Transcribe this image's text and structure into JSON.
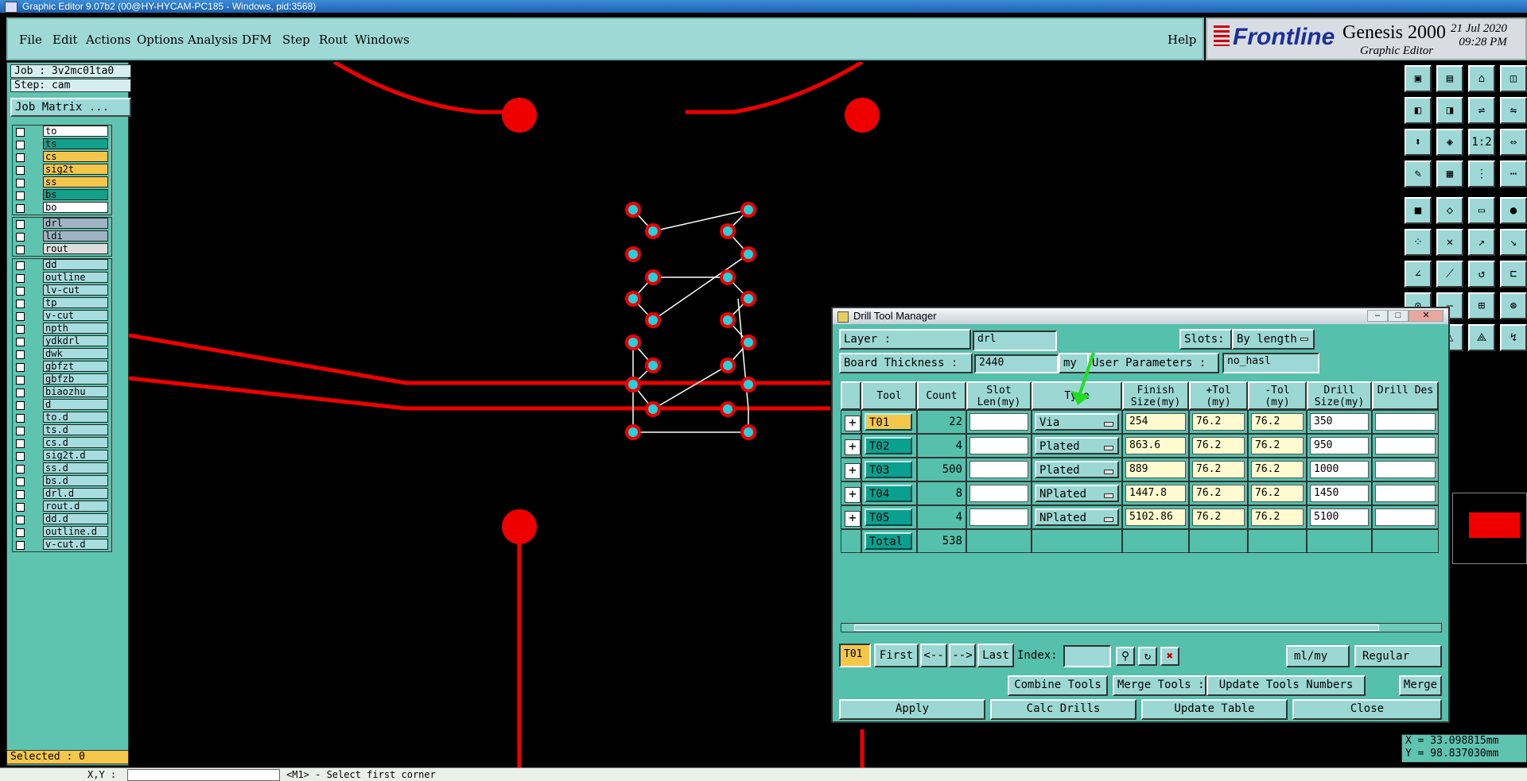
{
  "window": {
    "title": "Graphic Editor 9.07b2 (00@HY-HYCAM-PC185 - Windows, pid:3568)"
  },
  "menu": [
    "File",
    "Edit",
    "Actions",
    "Options",
    "Analysis",
    "DFM",
    "Step",
    "Rout",
    "Windows"
  ],
  "help_label": "Help",
  "logo": {
    "brand": "Frontline",
    "product": "Genesis 2000",
    "sub": "Graphic Editor",
    "date": "21 Jul 2020",
    "time": "09:28 PM"
  },
  "job": {
    "label": "Job : 3v2mc01ta0",
    "step": "Step: cam",
    "matrix_button": "Job Matrix ..."
  },
  "layers": {
    "group1": [
      {
        "name": "to",
        "color": "#ffffff"
      },
      {
        "name": "ts",
        "color": "#13a08a"
      },
      {
        "name": "cs",
        "color": "#f4c64a"
      },
      {
        "name": "sig2t",
        "color": "#f4c64a"
      },
      {
        "name": "ss",
        "color": "#f4c64a"
      },
      {
        "name": "bs",
        "color": "#13a08a"
      },
      {
        "name": "bo",
        "color": "#ffffff"
      }
    ],
    "group2": [
      {
        "name": "drl",
        "color": "#9fb4c2"
      },
      {
        "name": "ldi",
        "color": "#9fb4c2"
      },
      {
        "name": "rout",
        "color": "#dddddd"
      }
    ],
    "group3": [
      {
        "name": "dd",
        "color": "#a8dde0"
      },
      {
        "name": "outline",
        "color": "#a8dde0"
      },
      {
        "name": "lv-cut",
        "color": "#a8dde0"
      },
      {
        "name": "tp",
        "color": "#a8dde0"
      },
      {
        "name": "v-cut",
        "color": "#a8dde0"
      },
      {
        "name": "npth",
        "color": "#a8dde0"
      },
      {
        "name": "ydkdrl",
        "color": "#a8dde0"
      },
      {
        "name": "dwk",
        "color": "#a8dde0"
      },
      {
        "name": "gbfzt",
        "color": "#a8dde0"
      },
      {
        "name": "gbfzb",
        "color": "#a8dde0"
      },
      {
        "name": "biaozhu",
        "color": "#a8dde0"
      },
      {
        "name": "d",
        "color": "#a8dde0"
      },
      {
        "name": "to.d",
        "color": "#a8dde0"
      },
      {
        "name": "ts.d",
        "color": "#a8dde0"
      },
      {
        "name": "cs.d",
        "color": "#a8dde0"
      },
      {
        "name": "sig2t.d",
        "color": "#a8dde0"
      },
      {
        "name": "ss.d",
        "color": "#a8dde0"
      },
      {
        "name": "bs.d",
        "color": "#a8dde0"
      },
      {
        "name": "drl.d",
        "color": "#a8dde0"
      },
      {
        "name": "rout.d",
        "color": "#a8dde0"
      },
      {
        "name": "dd.d",
        "color": "#a8dde0"
      },
      {
        "name": "outline.d",
        "color": "#a8dde0"
      },
      {
        "name": "v-cut.d",
        "color": "#a8dde0"
      }
    ]
  },
  "selected": "Selected : 0",
  "status": {
    "xy_label": "X,Y :",
    "message": "<M1> - Select first corner"
  },
  "coords": {
    "x": "X = 33.098815mm",
    "y": "Y = 98.837030mm"
  },
  "dtm": {
    "title": "Drill Tool Manager",
    "layer_label": "Layer            :",
    "layer_value": "drl",
    "slots_label": "Slots:",
    "slots_value": "By length",
    "thickness_label": "Board Thickness :",
    "thickness_value": "2440",
    "thickness_unit": "my",
    "user_params_label": "User Parameters :",
    "user_params_value": "no_hasl",
    "headers": {
      "tool": "Tool",
      "count": "Count",
      "slot": "Slot Len(my)",
      "type": "Type",
      "finish": "Finish Size(my)",
      "ptol": "+Tol (my)",
      "ntol": "-Tol (my)",
      "drill": "Drill Size(my)",
      "des": "Drill Des"
    },
    "rows": [
      {
        "tool": "T01",
        "count": "22",
        "type": "Via",
        "finish": "254",
        "ptol": "76.2",
        "ntol": "76.2",
        "drill": "350"
      },
      {
        "tool": "T02",
        "count": "4",
        "type": "Plated",
        "finish": "863.6",
        "ptol": "76.2",
        "ntol": "76.2",
        "drill": "950"
      },
      {
        "tool": "T03",
        "count": "500",
        "type": "Plated",
        "finish": "889",
        "ptol": "76.2",
        "ntol": "76.2",
        "drill": "1000"
      },
      {
        "tool": "T04",
        "count": "8",
        "type": "NPlated",
        "finish": "1447.8",
        "ptol": "76.2",
        "ntol": "76.2",
        "drill": "1450"
      },
      {
        "tool": "T05",
        "count": "4",
        "type": "NPlated",
        "finish": "5102.86",
        "ptol": "76.2",
        "ntol": "76.2",
        "drill": "5100"
      }
    ],
    "total_label": "Total",
    "total_count": "538",
    "nav": {
      "current": "T01",
      "first": "First",
      "prev": "<--",
      "next": "-->",
      "last": "Last",
      "index": "Index:",
      "units": "ml/my",
      "mode": "Regular"
    },
    "combine": "Combine Tools",
    "merge_label": "Merge Tools :",
    "merge_value": "Update Tools Numbers",
    "merge": "Merge",
    "apply": "Apply",
    "calc": "Calc Drills",
    "update": "Update Table",
    "close": "Close"
  }
}
